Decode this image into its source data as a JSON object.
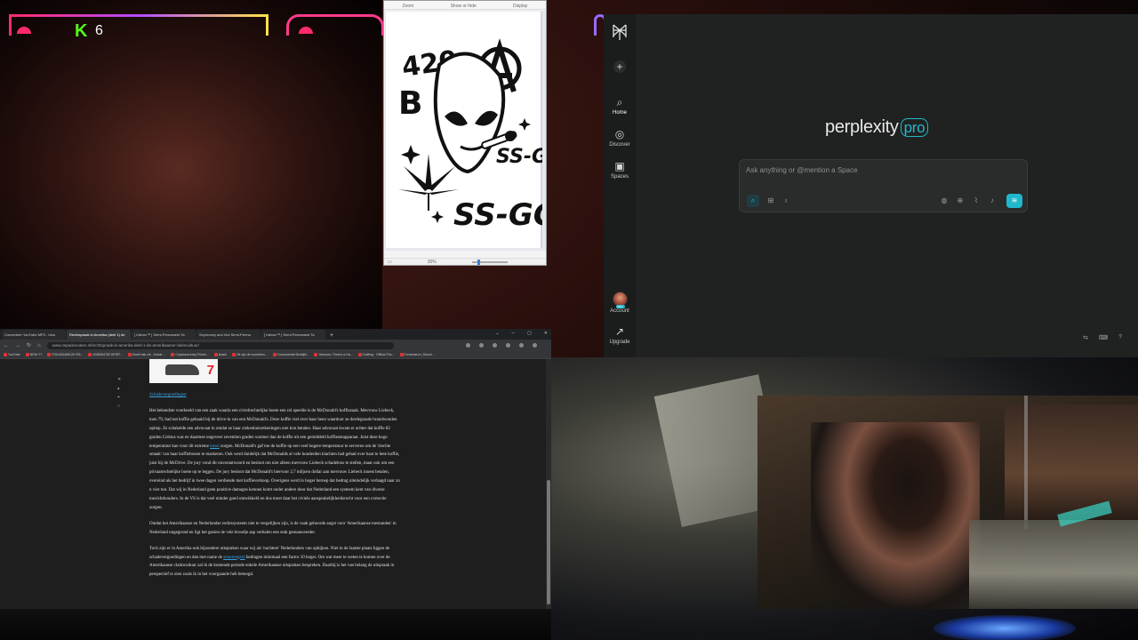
{
  "overlay": {
    "kick_count": "6"
  },
  "paint": {
    "ribbon": [
      "Zoom",
      "Show or hide",
      "Display"
    ],
    "zoom": "30%",
    "art": {
      "t420": "420",
      "anarchy": "A",
      "b": "B",
      "ssg": "SS-G",
      "ssgg": "SS-GG"
    }
  },
  "perplexity": {
    "nav": [
      {
        "label": ""
      },
      {
        "label": "Home"
      },
      {
        "label": "Discover"
      },
      {
        "label": "Spaces"
      }
    ],
    "account_label": "Account",
    "upgrade_label": "Upgrade",
    "brand": "perplexity",
    "brand_pro": "pro",
    "ask_placeholder": "Ask anything or @mention a Space",
    "avatar_tag": "PRO"
  },
  "browser": {
    "tabs": [
      "Converteer YouTube MP3 - Idoo",
      "Rechtspraak in Amerika (deel 1) de",
      "[ Inkbox™ ] Semi-Permanent Ta",
      "Seymoney and 2nd Semi-Perma",
      "[ Inkbox™ ] Semi-Permanent Ta"
    ],
    "url": "www.nspadvocaten.nl/rechtspraak-in-amerika-deel-1-de-amerikaanse-claimcultuur/",
    "bookmarks": [
      "YouTube",
      "NEW YT",
      "9781430465126 978...",
      "0038084783 HP/BT...",
      "Smeit nak zie - fortuin ...",
      "Cryptocurrency Prices...",
      "kbach",
      "Dit zijn de voordelen...",
      "Consumente Bedrijfd...",
      "Yahoons: There's a Ha...",
      "Crafting · Official The...",
      "Formenta.io | Kitoch ..."
    ],
    "article": {
      "heading": "Schadevergoedingen",
      "p1": " Het bekendste voorbeeld van een zaak waarin een civielrechtelijke boete een rol speelde is de McDonald's koffiezaak. Mevrouw Liebeck, toen 79, had net koffie gehaald bij de drive-in van een McDonald's. Deze koffie viel over haar heen waardoor ze derdegraads brandwonden opliep. Ze schakelde een advocaat in omdat ze haar ziekenhuisrekeningen niet kon betalen. Haar advocaat kwam er achter dat koffie 82 graden Celsius was en daarmee ongeveer zeventien graden warmer dan de koffie uit een gemiddeld koffiezetapparaat. Juist deze hoge temperatuur kan voor dit extreme ",
      "p1_link": "letsel",
      "p1_rest": " zorgen. McDonald's gaf toe de koffie op een veel hogere temperatuur te serveren om de 'slechte smaak' van haar koffiebonen te maskeren. Ook werd duidelijk dat McDonalds al vele honderden klachten had gehad over haar te hete koffie, juist bij de McDrive. De jury vond dit onverantwoord en besloot om niet alleen mevrouw Liebeck schadeloos te stellen, maar ook om een privaatrechtelijke boete op te leggen. De jury besloot dat McDonald's hiervoor 2,7 miljoen dollar aan mevrouw Liebeck moest betalen, overeind als het bedrijf in twee dagen verdiende met koffieverkoop. Overigens werd in hoger beroep dat bedrag uiteindelijk verlaagd naar zo n vier ton. Dat wij in Nederland geen punitive damages kennen komt onder andere door dat Nederland een systeem kent van diverse toezichthouders. In de VS is dat veel minder goed ontwikkeld en dus moet daar het civiele aansprakelijkheidsrecht voor een correctie zorgen.",
      "p2": "Omdat het Amerikaanse en Nederlandse rechtssysteem niet te vergelijken zijn, is de vaak gehoorde angst voor 'Amerikaanse toestanden' in Nederland ongegrond en ligt het gezien de vele broodje aap verhalen een stuk genuanceerder.",
      "p3": "Toch zijn er in Amerika ook bijzondere uitspraken waar wij als 'nuchtere' Nederlanders van opkijken. Niet in de laatste plaats liggen de schadevergoedingen en dan met name de ",
      "p3_link": "smartengeld",
      "p3_rest": " bedragen minimaal een factor 10 hoger.  Om wat meer te weten te komen over de Amerikaanse claimcultuur zal ik de komende periode enkele Amerikaanse uitspraken bespreken. Daarbij is het van belang de uitspraak in perspectief te zien zoals ik in het voorgaande heb betoogd."
    }
  },
  "colors": {
    "pplx_accent": "#20b8cd",
    "kick_green": "#53fc18",
    "link_blue": "#39a0e2"
  },
  "icons": {
    "sidebar": [
      "plus-icon",
      "home-icon",
      "discover-icon",
      "spaces-icon"
    ],
    "ask_tools": [
      "search-focus-icon",
      "grid-icon",
      "bulb-icon",
      "globe-icon",
      "globe-icon",
      "attach-icon",
      "mic-icon",
      "voice-mode-icon"
    ]
  }
}
